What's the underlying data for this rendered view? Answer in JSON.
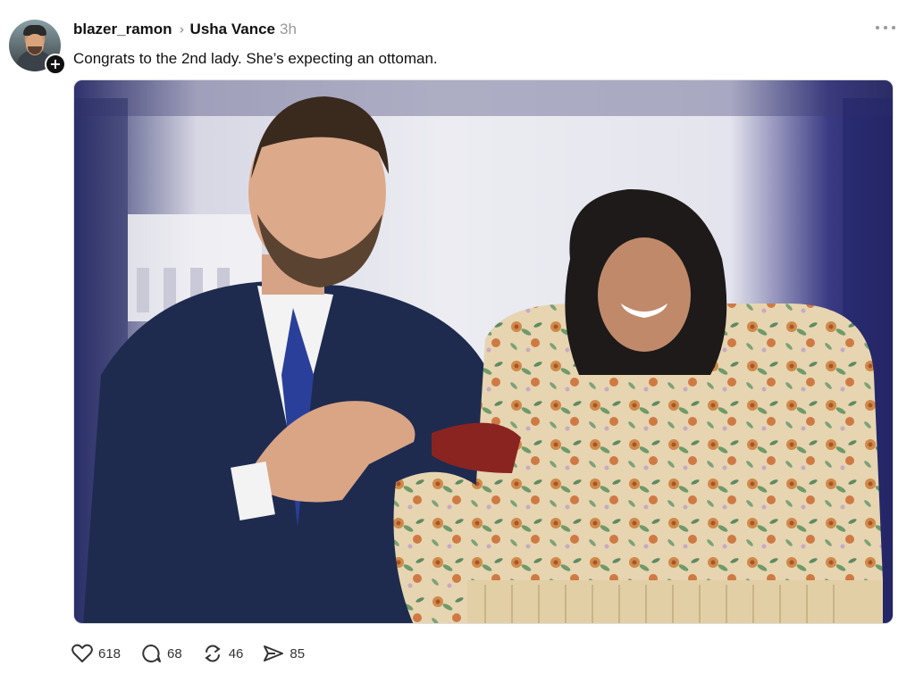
{
  "post": {
    "author": "blazer_ramon",
    "reply_to": "Usha Vance",
    "timestamp": "3h",
    "text": "Congrats to the 2nd lady. She’s expecting an ottoman.",
    "follow_badge": "+",
    "more_icon": "more-horizontal-icon"
  },
  "actions": {
    "likes": "618",
    "comments": "68",
    "reposts": "46",
    "shares": "85"
  },
  "icons": [
    "heart-icon",
    "comment-icon",
    "repost-icon",
    "share-icon"
  ],
  "colors": {
    "text": "#111111",
    "muted": "#9a9a9a",
    "suit_blue": "#1e2b4f",
    "tie_blue": "#2a3f9a",
    "chair_fabric": "#e4d3ad"
  }
}
